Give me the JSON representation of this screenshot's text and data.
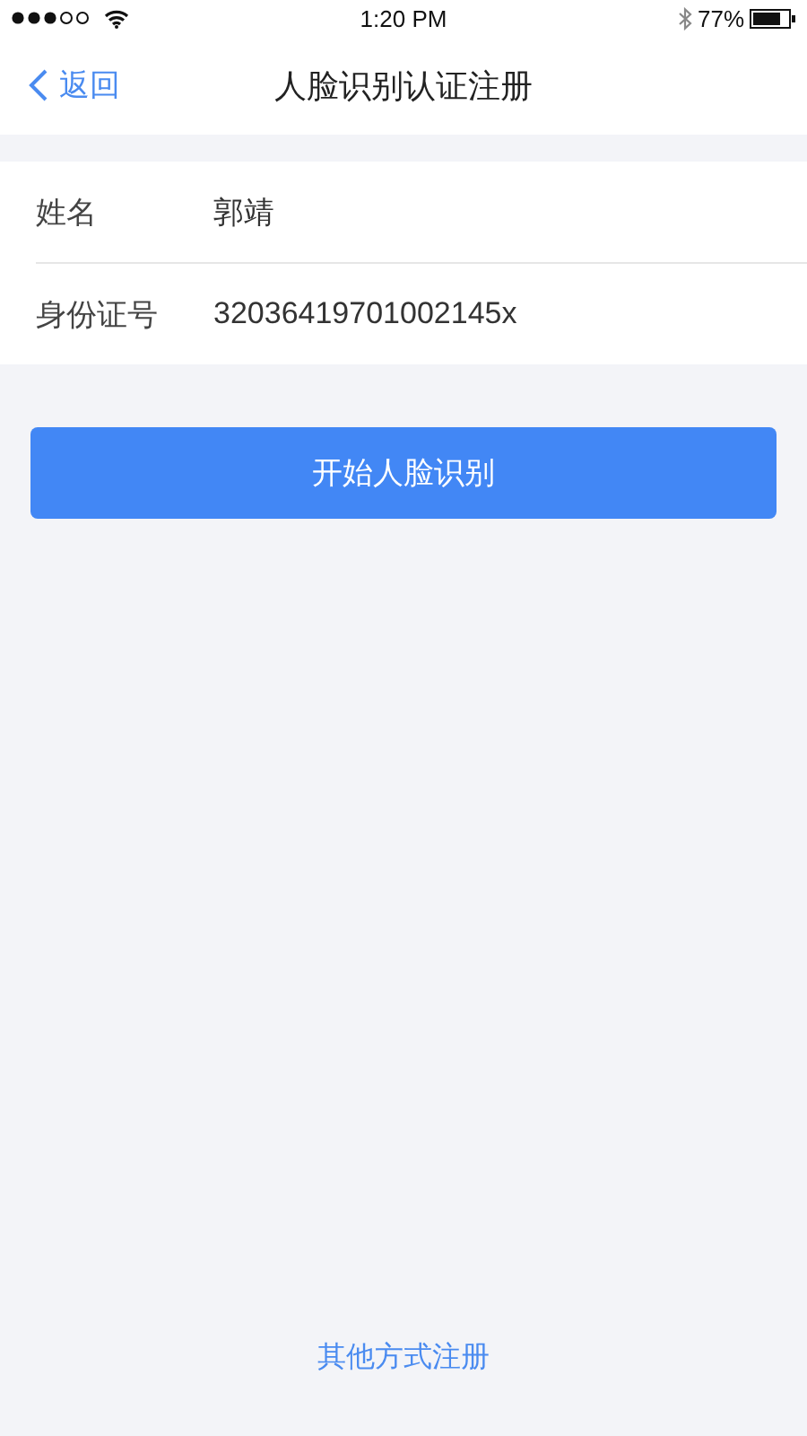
{
  "status_bar": {
    "time": "1:20 PM",
    "battery": "77%"
  },
  "nav": {
    "back": "返回",
    "title": "人脸识别认证注册"
  },
  "fields": [
    {
      "label": "姓名",
      "value": "郭靖"
    },
    {
      "label": "身份证号",
      "value": "32036419701002145x"
    }
  ],
  "primary_button": "开始人脸识别",
  "footer_link": "其他方式注册"
}
